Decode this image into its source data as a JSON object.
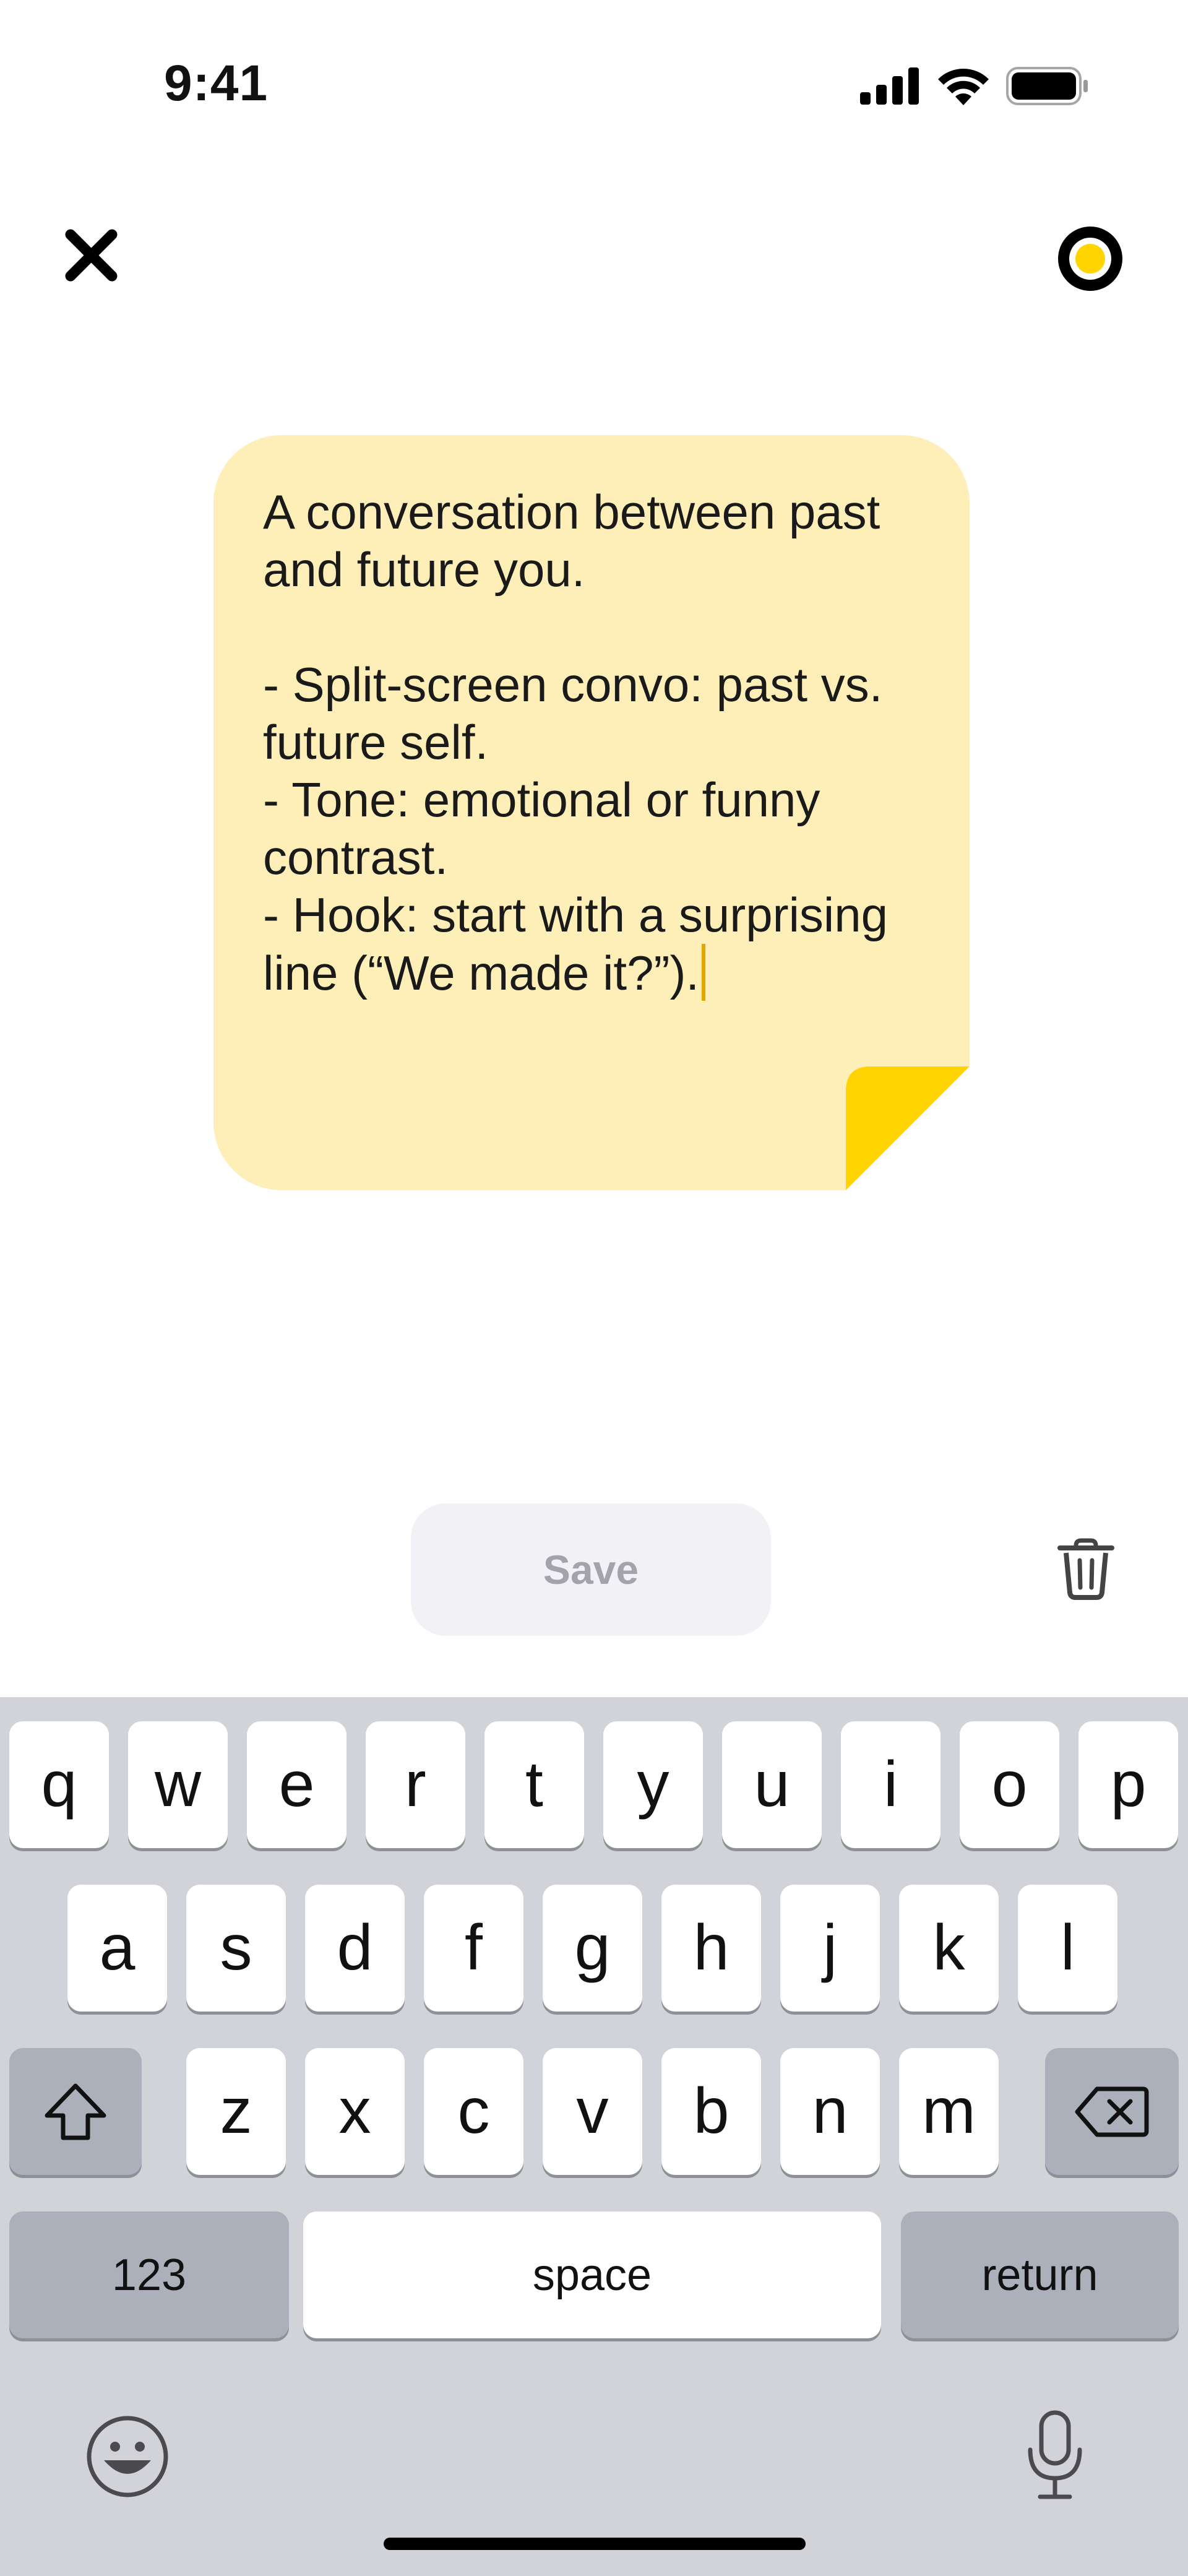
{
  "status_bar": {
    "time": "9:41",
    "icons": [
      "cellular-signal-icon",
      "wifi-icon",
      "battery-icon"
    ]
  },
  "toolbar": {
    "close_icon": "close-icon",
    "record_icon": "record-icon"
  },
  "note": {
    "text": "A conversation between past\nand future you.\n\n- Split-screen convo: past vs.\nfuture self.\n- Tone: emotional or funny\ncontrast.\n- Hook: start with a surprising\nline (“We made it?”).",
    "background_color": "#feefb8",
    "fold_color": "#ffd400"
  },
  "actions": {
    "save_label": "Save",
    "delete_icon": "trash-icon"
  },
  "keyboard": {
    "row1": [
      "q",
      "w",
      "e",
      "r",
      "t",
      "y",
      "u",
      "i",
      "o",
      "p"
    ],
    "row2": [
      "a",
      "s",
      "d",
      "f",
      "g",
      "h",
      "j",
      "k",
      "l"
    ],
    "row3": [
      "z",
      "x",
      "c",
      "v",
      "b",
      "n",
      "m"
    ],
    "shift_icon": "shift-icon",
    "backspace_icon": "backspace-icon",
    "numbers_label": "123",
    "space_label": "space",
    "return_label": "return",
    "emoji_icon": "emoji-icon",
    "mic_icon": "microphone-icon"
  }
}
